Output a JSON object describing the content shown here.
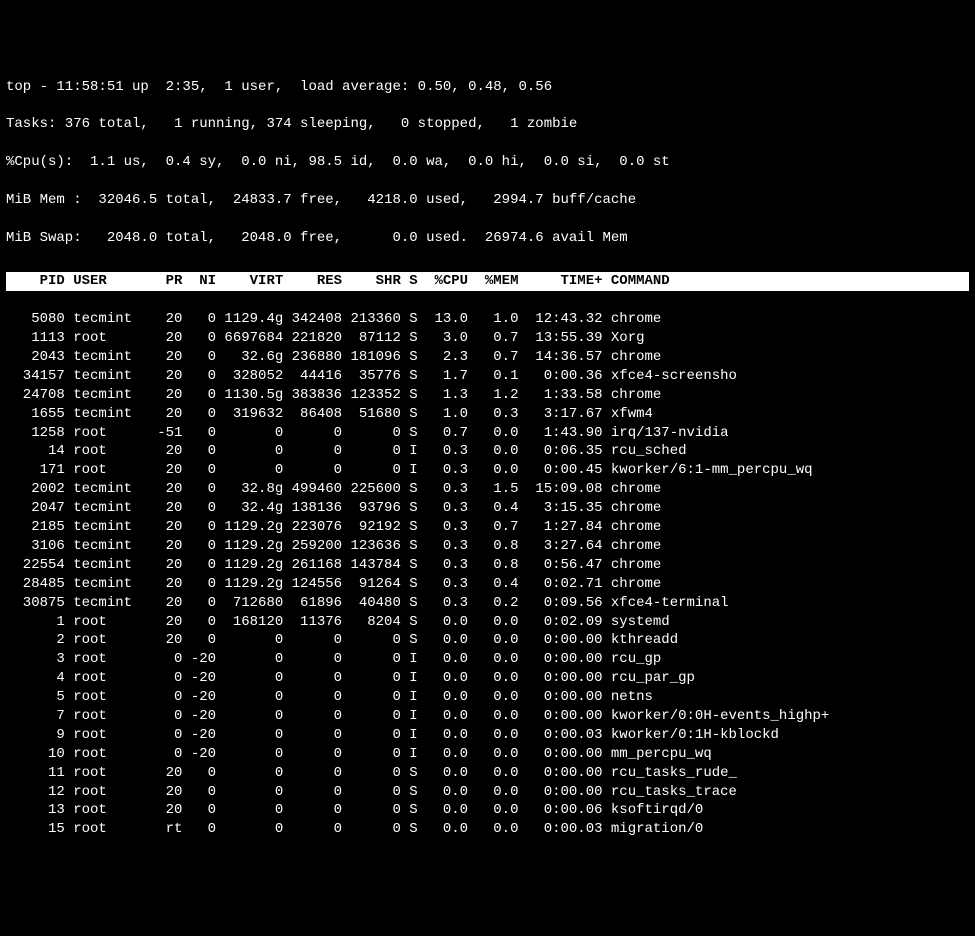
{
  "summary": {
    "line1": "top - 11:58:51 up  2:35,  1 user,  load average: 0.50, 0.48, 0.56",
    "line2": "Tasks: 376 total,   1 running, 374 sleeping,   0 stopped,   1 zombie",
    "line3": "%Cpu(s):  1.1 us,  0.4 sy,  0.0 ni, 98.5 id,  0.0 wa,  0.0 hi,  0.0 si,  0.0 st",
    "line4": "MiB Mem :  32046.5 total,  24833.7 free,   4218.0 used,   2994.7 buff/cache",
    "line5": "MiB Swap:   2048.0 total,   2048.0 free,      0.0 used.  26974.6 avail Mem"
  },
  "columns": [
    "PID",
    "USER",
    "PR",
    "NI",
    "VIRT",
    "RES",
    "SHR",
    "S",
    "%CPU",
    "%MEM",
    "TIME+",
    "COMMAND"
  ],
  "processes": [
    {
      "pid": "5080",
      "user": "tecmint",
      "pr": "20",
      "ni": "0",
      "virt": "1129.4g",
      "res": "342408",
      "shr": "213360",
      "s": "S",
      "cpu": "13.0",
      "mem": "1.0",
      "time": "12:43.32",
      "cmd": "chrome"
    },
    {
      "pid": "1113",
      "user": "root",
      "pr": "20",
      "ni": "0",
      "virt": "6697684",
      "res": "221820",
      "shr": "87112",
      "s": "S",
      "cpu": "3.0",
      "mem": "0.7",
      "time": "13:55.39",
      "cmd": "Xorg"
    },
    {
      "pid": "2043",
      "user": "tecmint",
      "pr": "20",
      "ni": "0",
      "virt": "32.6g",
      "res": "236880",
      "shr": "181096",
      "s": "S",
      "cpu": "2.3",
      "mem": "0.7",
      "time": "14:36.57",
      "cmd": "chrome"
    },
    {
      "pid": "34157",
      "user": "tecmint",
      "pr": "20",
      "ni": "0",
      "virt": "328052",
      "res": "44416",
      "shr": "35776",
      "s": "S",
      "cpu": "1.7",
      "mem": "0.1",
      "time": "0:00.36",
      "cmd": "xfce4-screensho"
    },
    {
      "pid": "24708",
      "user": "tecmint",
      "pr": "20",
      "ni": "0",
      "virt": "1130.5g",
      "res": "383836",
      "shr": "123352",
      "s": "S",
      "cpu": "1.3",
      "mem": "1.2",
      "time": "1:33.58",
      "cmd": "chrome"
    },
    {
      "pid": "1655",
      "user": "tecmint",
      "pr": "20",
      "ni": "0",
      "virt": "319632",
      "res": "86408",
      "shr": "51680",
      "s": "S",
      "cpu": "1.0",
      "mem": "0.3",
      "time": "3:17.67",
      "cmd": "xfwm4"
    },
    {
      "pid": "1258",
      "user": "root",
      "pr": "-51",
      "ni": "0",
      "virt": "0",
      "res": "0",
      "shr": "0",
      "s": "S",
      "cpu": "0.7",
      "mem": "0.0",
      "time": "1:43.90",
      "cmd": "irq/137-nvidia"
    },
    {
      "pid": "14",
      "user": "root",
      "pr": "20",
      "ni": "0",
      "virt": "0",
      "res": "0",
      "shr": "0",
      "s": "I",
      "cpu": "0.3",
      "mem": "0.0",
      "time": "0:06.35",
      "cmd": "rcu_sched"
    },
    {
      "pid": "171",
      "user": "root",
      "pr": "20",
      "ni": "0",
      "virt": "0",
      "res": "0",
      "shr": "0",
      "s": "I",
      "cpu": "0.3",
      "mem": "0.0",
      "time": "0:00.45",
      "cmd": "kworker/6:1-mm_percpu_wq"
    },
    {
      "pid": "2002",
      "user": "tecmint",
      "pr": "20",
      "ni": "0",
      "virt": "32.8g",
      "res": "499460",
      "shr": "225600",
      "s": "S",
      "cpu": "0.3",
      "mem": "1.5",
      "time": "15:09.08",
      "cmd": "chrome"
    },
    {
      "pid": "2047",
      "user": "tecmint",
      "pr": "20",
      "ni": "0",
      "virt": "32.4g",
      "res": "138136",
      "shr": "93796",
      "s": "S",
      "cpu": "0.3",
      "mem": "0.4",
      "time": "3:15.35",
      "cmd": "chrome"
    },
    {
      "pid": "2185",
      "user": "tecmint",
      "pr": "20",
      "ni": "0",
      "virt": "1129.2g",
      "res": "223076",
      "shr": "92192",
      "s": "S",
      "cpu": "0.3",
      "mem": "0.7",
      "time": "1:27.84",
      "cmd": "chrome"
    },
    {
      "pid": "3106",
      "user": "tecmint",
      "pr": "20",
      "ni": "0",
      "virt": "1129.2g",
      "res": "259200",
      "shr": "123636",
      "s": "S",
      "cpu": "0.3",
      "mem": "0.8",
      "time": "3:27.64",
      "cmd": "chrome"
    },
    {
      "pid": "22554",
      "user": "tecmint",
      "pr": "20",
      "ni": "0",
      "virt": "1129.2g",
      "res": "261168",
      "shr": "143784",
      "s": "S",
      "cpu": "0.3",
      "mem": "0.8",
      "time": "0:56.47",
      "cmd": "chrome"
    },
    {
      "pid": "28485",
      "user": "tecmint",
      "pr": "20",
      "ni": "0",
      "virt": "1129.2g",
      "res": "124556",
      "shr": "91264",
      "s": "S",
      "cpu": "0.3",
      "mem": "0.4",
      "time": "0:02.71",
      "cmd": "chrome"
    },
    {
      "pid": "30875",
      "user": "tecmint",
      "pr": "20",
      "ni": "0",
      "virt": "712680",
      "res": "61896",
      "shr": "40480",
      "s": "S",
      "cpu": "0.3",
      "mem": "0.2",
      "time": "0:09.56",
      "cmd": "xfce4-terminal"
    },
    {
      "pid": "1",
      "user": "root",
      "pr": "20",
      "ni": "0",
      "virt": "168120",
      "res": "11376",
      "shr": "8204",
      "s": "S",
      "cpu": "0.0",
      "mem": "0.0",
      "time": "0:02.09",
      "cmd": "systemd"
    },
    {
      "pid": "2",
      "user": "root",
      "pr": "20",
      "ni": "0",
      "virt": "0",
      "res": "0",
      "shr": "0",
      "s": "S",
      "cpu": "0.0",
      "mem": "0.0",
      "time": "0:00.00",
      "cmd": "kthreadd"
    },
    {
      "pid": "3",
      "user": "root",
      "pr": "0",
      "ni": "-20",
      "virt": "0",
      "res": "0",
      "shr": "0",
      "s": "I",
      "cpu": "0.0",
      "mem": "0.0",
      "time": "0:00.00",
      "cmd": "rcu_gp"
    },
    {
      "pid": "4",
      "user": "root",
      "pr": "0",
      "ni": "-20",
      "virt": "0",
      "res": "0",
      "shr": "0",
      "s": "I",
      "cpu": "0.0",
      "mem": "0.0",
      "time": "0:00.00",
      "cmd": "rcu_par_gp"
    },
    {
      "pid": "5",
      "user": "root",
      "pr": "0",
      "ni": "-20",
      "virt": "0",
      "res": "0",
      "shr": "0",
      "s": "I",
      "cpu": "0.0",
      "mem": "0.0",
      "time": "0:00.00",
      "cmd": "netns"
    },
    {
      "pid": "7",
      "user": "root",
      "pr": "0",
      "ni": "-20",
      "virt": "0",
      "res": "0",
      "shr": "0",
      "s": "I",
      "cpu": "0.0",
      "mem": "0.0",
      "time": "0:00.00",
      "cmd": "kworker/0:0H-events_highp+"
    },
    {
      "pid": "9",
      "user": "root",
      "pr": "0",
      "ni": "-20",
      "virt": "0",
      "res": "0",
      "shr": "0",
      "s": "I",
      "cpu": "0.0",
      "mem": "0.0",
      "time": "0:00.03",
      "cmd": "kworker/0:1H-kblockd"
    },
    {
      "pid": "10",
      "user": "root",
      "pr": "0",
      "ni": "-20",
      "virt": "0",
      "res": "0",
      "shr": "0",
      "s": "I",
      "cpu": "0.0",
      "mem": "0.0",
      "time": "0:00.00",
      "cmd": "mm_percpu_wq"
    },
    {
      "pid": "11",
      "user": "root",
      "pr": "20",
      "ni": "0",
      "virt": "0",
      "res": "0",
      "shr": "0",
      "s": "S",
      "cpu": "0.0",
      "mem": "0.0",
      "time": "0:00.00",
      "cmd": "rcu_tasks_rude_"
    },
    {
      "pid": "12",
      "user": "root",
      "pr": "20",
      "ni": "0",
      "virt": "0",
      "res": "0",
      "shr": "0",
      "s": "S",
      "cpu": "0.0",
      "mem": "0.0",
      "time": "0:00.00",
      "cmd": "rcu_tasks_trace"
    },
    {
      "pid": "13",
      "user": "root",
      "pr": "20",
      "ni": "0",
      "virt": "0",
      "res": "0",
      "shr": "0",
      "s": "S",
      "cpu": "0.0",
      "mem": "0.0",
      "time": "0:00.06",
      "cmd": "ksoftirqd/0"
    },
    {
      "pid": "15",
      "user": "root",
      "pr": "rt",
      "ni": "0",
      "virt": "0",
      "res": "0",
      "shr": "0",
      "s": "S",
      "cpu": "0.0",
      "mem": "0.0",
      "time": "0:00.03",
      "cmd": "migration/0"
    }
  ]
}
